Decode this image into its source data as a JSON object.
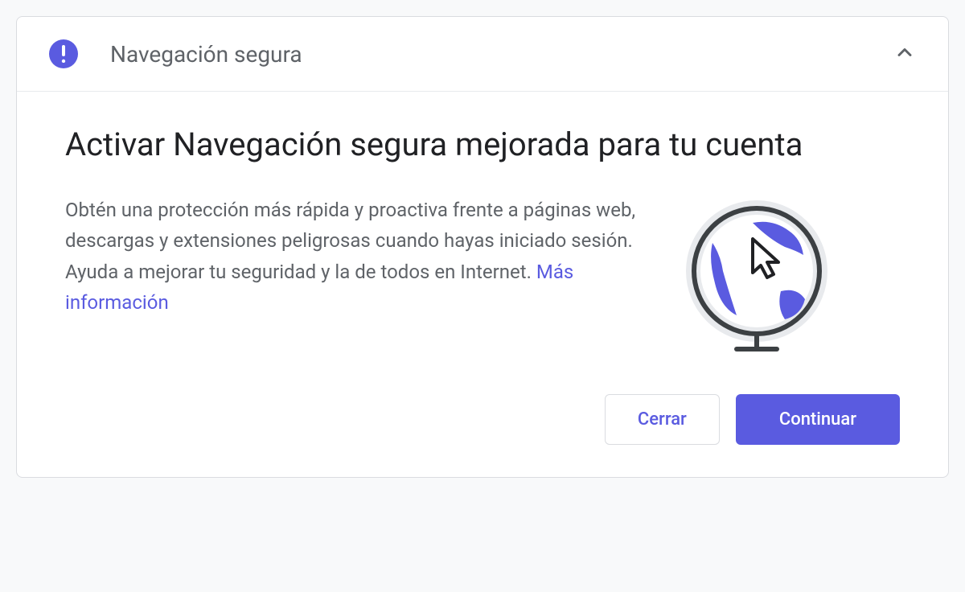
{
  "header": {
    "title": "Navegación segura"
  },
  "content": {
    "title": "Activar Navegación segura mejorada para tu cuenta",
    "description": "Obtén una protección más rápida y proactiva frente a páginas web, descargas y extensiones peligrosas cuando hayas iniciado sesión. Ayuda a mejorar tu seguridad y la de todos en Internet. ",
    "more_info_label": "Más información"
  },
  "actions": {
    "close_label": "Cerrar",
    "continue_label": "Continuar"
  }
}
